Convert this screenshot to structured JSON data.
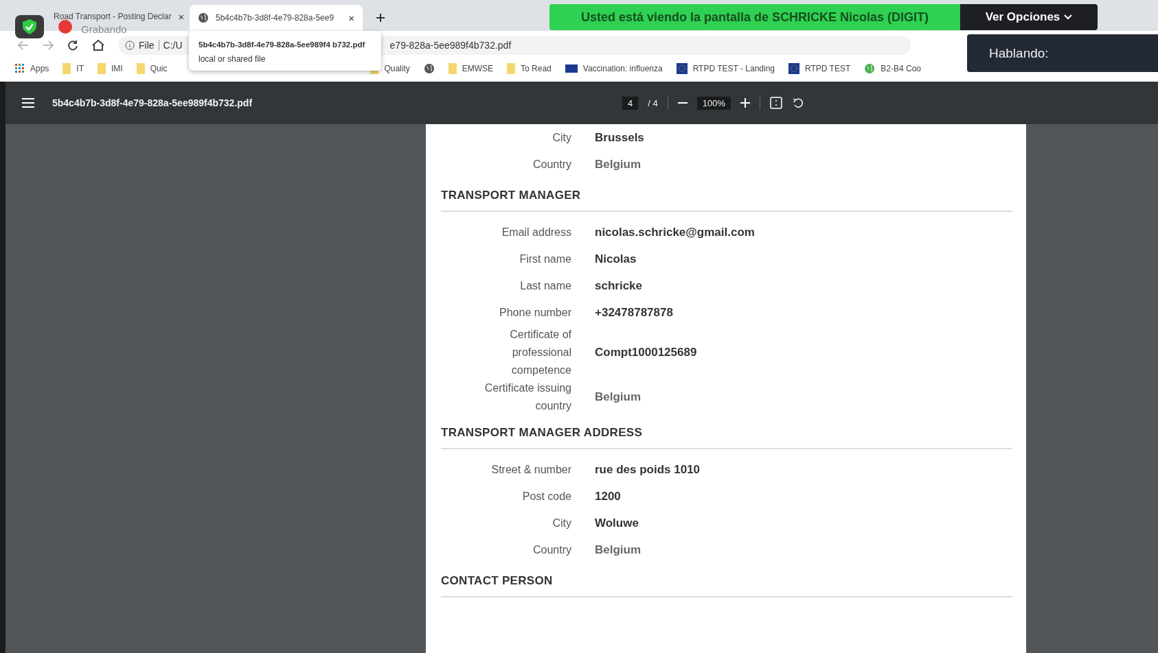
{
  "browser": {
    "tabs": [
      {
        "title": "Road Transport - Posting Declar",
        "close": "×",
        "selected": false
      },
      {
        "title": "5b4c4b7b-3d8f-4e79-828a-5ee9",
        "close": "×",
        "selected": true
      }
    ],
    "address": {
      "scheme": "File",
      "path_start": "C:/U",
      "path_end": "e79-828a-5ee989f4b732.pdf"
    },
    "bookmarks_left": [
      {
        "kind": "apps",
        "label": "Apps"
      },
      {
        "kind": "folder",
        "label": "IT"
      },
      {
        "kind": "folder",
        "label": "IMI"
      },
      {
        "kind": "folder",
        "label": "Quic"
      }
    ],
    "bookmarks_right": [
      {
        "kind": "folder",
        "label": "Quality"
      },
      {
        "kind": "globe"
      },
      {
        "kind": "folder",
        "label": "EMWSE"
      },
      {
        "kind": "folder",
        "label": "To Read"
      },
      {
        "kind": "flag",
        "label": "Vaccination: influenza"
      },
      {
        "kind": "eu",
        "label": "RTPD TEST - Landing"
      },
      {
        "kind": "eu",
        "label": "RTPD TEST"
      },
      {
        "kind": "earth",
        "label": "B2-B4 Coo"
      }
    ],
    "tooltip": {
      "title": "5b4c4b7b-3d8f-4e79-828a-5ee989f4 b732.pdf",
      "subtitle": "local or shared file"
    }
  },
  "meeting": {
    "banner": "Usted está viendo la pantalla de SCHRICKE Nicolas (DIGIT)",
    "options": "Ver Opciones",
    "speaking": "Hablando:",
    "recording": "Grabando"
  },
  "viewer": {
    "filename": "5b4c4b7b-3d8f-4e79-828a-5ee989f4b732.pdf",
    "page": "4",
    "page_total": "/ 4",
    "zoom": "100%"
  },
  "document": [
    {
      "kind": "field",
      "label": "City",
      "value": "Brussels",
      "muted": false
    },
    {
      "kind": "field",
      "label": "Country",
      "value": "Belgium",
      "muted": true
    },
    {
      "kind": "heading",
      "label": "TRANSPORT MANAGER"
    },
    {
      "kind": "field",
      "label": "Email address",
      "value": "nicolas.schricke@gmail.com",
      "muted": false
    },
    {
      "kind": "field",
      "label": "First name",
      "value": "Nicolas",
      "muted": false
    },
    {
      "kind": "field",
      "label": "Last name",
      "value": "schricke",
      "muted": false
    },
    {
      "kind": "field",
      "label": "Phone number",
      "value": "+32478787878",
      "muted": false
    },
    {
      "kind": "field",
      "label": "Certificate of professional competence",
      "value": "Compt1000125689",
      "muted": false
    },
    {
      "kind": "field",
      "label": "Certificate issuing country",
      "value": "Belgium",
      "muted": true
    },
    {
      "kind": "heading",
      "label": "TRANSPORT MANAGER ADDRESS"
    },
    {
      "kind": "field",
      "label": "Street & number",
      "value": "rue des poids 1010",
      "muted": false
    },
    {
      "kind": "field",
      "label": "Post code",
      "value": "1200",
      "muted": false
    },
    {
      "kind": "field",
      "label": "City",
      "value": "Woluwe",
      "muted": false
    },
    {
      "kind": "field",
      "label": "Country",
      "value": "Belgium",
      "muted": true
    },
    {
      "kind": "heading",
      "label": "CONTACT PERSON"
    }
  ]
}
